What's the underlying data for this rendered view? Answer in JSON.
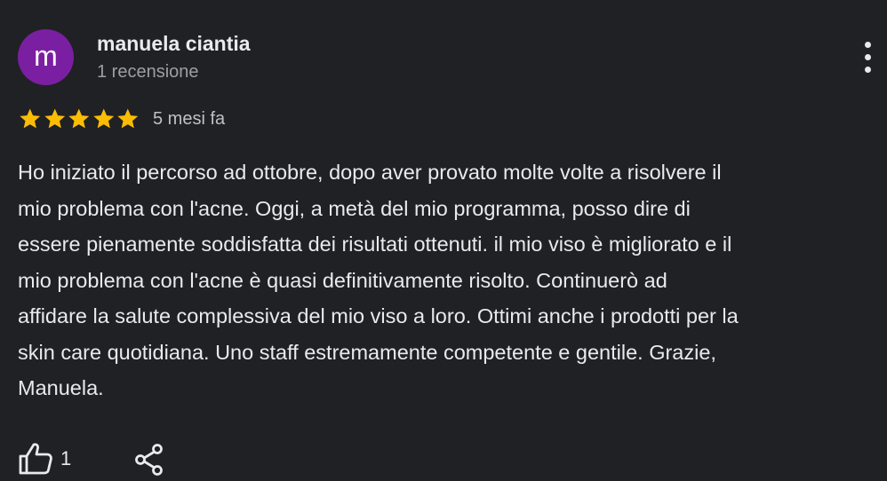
{
  "review": {
    "author": {
      "initial": "m",
      "name": "manuela ciantia",
      "meta": "1 recensione",
      "avatar_color": "#7b1fa2"
    },
    "menu_icon": "more-vert-icon",
    "rating": {
      "value": 5,
      "max": 5,
      "star_color": "#fbbc04"
    },
    "time_ago": "5 mesi fa",
    "text_lines": [
      "Ho iniziato il percorso ad ottobre, dopo aver provato molte volte a risolvere il",
      "mio problema con l'acne. Oggi, a metà del mio programma, posso dire di",
      "essere pienamente soddisfatta dei risultati ottenuti. il mio viso è migliorato e il",
      "mio problema con l'acne è quasi definitivamente risolto. Continuerò ad",
      "affidare la salute complessiva del mio viso a loro. Ottimi anche i prodotti per la",
      "skin care quotidiana. Uno staff estremamente competente e gentile. Grazie,",
      "Manuela."
    ],
    "actions": {
      "like_icon": "thumb-up-icon",
      "like_count": "1",
      "share_icon": "share-icon"
    }
  }
}
